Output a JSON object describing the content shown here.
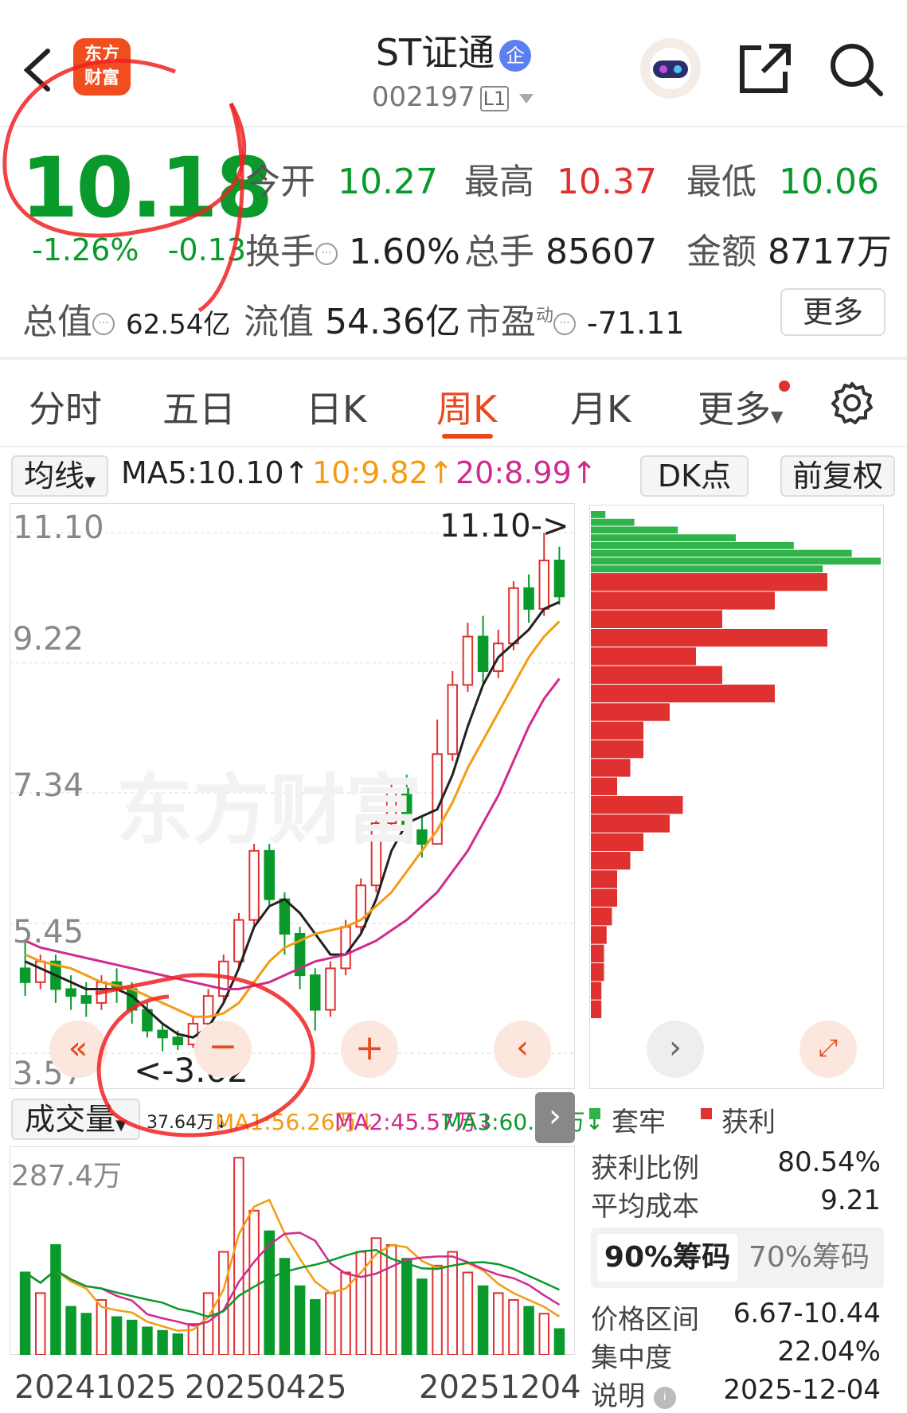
{
  "header": {
    "stock_name": "ST证通",
    "qi_badge": "企",
    "stock_code": "002197",
    "level_badge": "L1",
    "app_logo_text": [
      "东方",
      "财富"
    ]
  },
  "quote": {
    "price": "10.18",
    "change_pct": "-1.26%",
    "change_amt": "-0.13",
    "open_label": "今开",
    "open": "10.27",
    "high_label": "最高",
    "high": "10.37",
    "low_label": "最低",
    "low": "10.06",
    "turnover_label": "换手",
    "turnover": "1.60%",
    "volume_label": "总手",
    "volume": "85607",
    "amount_label": "金额",
    "amount": "8717万",
    "mktcap_label": "总值",
    "mktcap": "62.54亿",
    "float_label": "流值",
    "float_cap": "54.36亿",
    "pe_label": "市盈",
    "pe_sup": "动",
    "pe": "-71.11",
    "more_label": "更多"
  },
  "tabs": [
    {
      "label": "分时"
    },
    {
      "label": "五日"
    },
    {
      "label": "日K"
    },
    {
      "label": "周K"
    },
    {
      "label": "月K"
    },
    {
      "label": "更多"
    }
  ],
  "ma_bar": {
    "selector": "均线",
    "ma5": "MA5:10.10↑",
    "ma10": "10:9.82↑",
    "ma20": "20:8.99↑",
    "dk_label": "DK点",
    "adj_label": "前复权"
  },
  "price_axis": [
    "11.10",
    "9.22",
    "7.34",
    "5.45",
    "3.57"
  ],
  "annotations": {
    "high_marker": "11.10->",
    "low_marker": "<-3.62"
  },
  "watermark": "东方财富",
  "volume_bar": {
    "label": "成交量",
    "vol_value": "37.64万↓",
    "ma1": "MA1:56.26万↓",
    "ma2": "MA2:45.57万↓",
    "ma3": "MA3:60.52万↓",
    "axis_top": "287.4万"
  },
  "dates": [
    "20241025",
    "20250425",
    "20251204"
  ],
  "chip": {
    "legend_loss": "套牢",
    "legend_profit": "获利",
    "profit_ratio_label": "获利比例",
    "profit_ratio": "80.54%",
    "avg_cost_label": "平均成本",
    "avg_cost": "9.21",
    "tab90": "90%筹码",
    "tab70": "70%筹码",
    "range_label": "价格区间",
    "range": "6.67-10.44",
    "conc_label": "集中度",
    "conc": "22.04%",
    "note_label": "说明",
    "note_date": "2025-12-04"
  },
  "colors": {
    "up": "#e03131",
    "down": "#0a9a2c",
    "ma5": "#222222",
    "ma10": "#f39c12",
    "ma20": "#d02a8e",
    "accent": "#e8491d"
  },
  "chart_data": {
    "type": "candlestick",
    "title": "",
    "y_ticks": [
      11.1,
      9.22,
      7.34,
      5.45,
      3.57
    ],
    "ylim": [
      3.4,
      11.3
    ],
    "x_tick_labels": [
      "20241025",
      "20250425",
      "20251204"
    ],
    "candles": [
      [
        4.8,
        4.6,
        5.2,
        4.4
      ],
      [
        4.6,
        4.9,
        5.0,
        4.5
      ],
      [
        4.9,
        4.5,
        5.0,
        4.3
      ],
      [
        4.5,
        4.4,
        4.7,
        4.2
      ],
      [
        4.4,
        4.3,
        4.6,
        4.1
      ],
      [
        4.3,
        4.6,
        4.7,
        4.2
      ],
      [
        4.6,
        4.5,
        4.8,
        4.3
      ],
      [
        4.5,
        4.2,
        4.6,
        4.0
      ],
      [
        4.2,
        3.9,
        4.3,
        3.8
      ],
      [
        3.9,
        3.8,
        4.0,
        3.6
      ],
      [
        3.8,
        3.7,
        3.9,
        3.62
      ],
      [
        3.7,
        4.0,
        4.1,
        3.65
      ],
      [
        4.0,
        4.4,
        4.5,
        3.9
      ],
      [
        4.4,
        4.9,
        5.0,
        4.3
      ],
      [
        4.9,
        5.5,
        5.6,
        4.8
      ],
      [
        5.5,
        6.5,
        6.6,
        5.4
      ],
      [
        6.5,
        5.8,
        6.6,
        5.7
      ],
      [
        5.8,
        5.3,
        5.9,
        5.0
      ],
      [
        5.3,
        4.7,
        5.4,
        4.5
      ],
      [
        4.7,
        4.2,
        4.8,
        3.9
      ],
      [
        4.2,
        4.8,
        4.9,
        4.1
      ],
      [
        4.8,
        5.4,
        5.5,
        4.7
      ],
      [
        5.4,
        6.0,
        6.1,
        5.3
      ],
      [
        6.0,
        6.9,
        7.0,
        5.9
      ],
      [
        6.9,
        7.4,
        7.5,
        6.8
      ],
      [
        7.4,
        6.8,
        7.6,
        6.6
      ],
      [
        6.8,
        6.6,
        7.0,
        6.4
      ],
      [
        6.6,
        7.9,
        8.4,
        6.6
      ],
      [
        7.9,
        8.9,
        9.1,
        7.8
      ],
      [
        8.9,
        9.6,
        9.8,
        8.8
      ],
      [
        9.6,
        9.1,
        9.9,
        8.9
      ],
      [
        9.1,
        9.5,
        9.7,
        9.0
      ],
      [
        9.5,
        10.3,
        10.4,
        9.4
      ],
      [
        10.3,
        10.0,
        10.5,
        9.8
      ],
      [
        10.0,
        10.7,
        11.1,
        9.9
      ],
      [
        10.7,
        10.18,
        10.9,
        10.06
      ]
    ],
    "ma5": [
      4.9,
      4.8,
      4.7,
      4.6,
      4.5,
      4.5,
      4.5,
      4.4,
      4.2,
      4.0,
      3.85,
      3.8,
      3.95,
      4.3,
      4.8,
      5.4,
      5.7,
      5.8,
      5.6,
      5.3,
      5.0,
      5.0,
      5.3,
      5.8,
      6.5,
      6.9,
      7.0,
      7.1,
      7.6,
      8.3,
      8.9,
      9.3,
      9.5,
      9.7,
      10.0,
      10.1
    ],
    "ma10": [
      5.0,
      4.9,
      4.85,
      4.8,
      4.7,
      4.6,
      4.55,
      4.5,
      4.4,
      4.3,
      4.2,
      4.1,
      4.1,
      4.15,
      4.3,
      4.6,
      4.9,
      5.1,
      5.2,
      5.3,
      5.35,
      5.4,
      5.5,
      5.7,
      5.9,
      6.2,
      6.5,
      6.8,
      7.2,
      7.7,
      8.1,
      8.5,
      8.9,
      9.3,
      9.6,
      9.82
    ],
    "ma20": [
      5.2,
      5.1,
      5.05,
      5.0,
      4.95,
      4.9,
      4.85,
      4.8,
      4.75,
      4.7,
      4.65,
      4.6,
      4.55,
      4.5,
      4.5,
      4.55,
      4.6,
      4.7,
      4.8,
      4.9,
      4.95,
      5.0,
      5.1,
      5.2,
      5.35,
      5.5,
      5.7,
      5.9,
      6.2,
      6.5,
      6.9,
      7.3,
      7.8,
      8.3,
      8.7,
      8.99
    ],
    "volume_wan": [
      120,
      90,
      160,
      70,
      60,
      80,
      55,
      50,
      40,
      35,
      30,
      45,
      90,
      150,
      287,
      210,
      180,
      140,
      100,
      80,
      90,
      120,
      150,
      170,
      160,
      140,
      110,
      130,
      150,
      120,
      100,
      90,
      80,
      70,
      60,
      37.64
    ],
    "chip_distribution": {
      "price_range": [
        3.57,
        11.1
      ],
      "loss_levels": [
        0.05,
        0.15,
        0.3,
        0.5,
        0.7,
        0.9,
        1.0,
        0.8
      ],
      "profit_levels": [
        0.9,
        0.7,
        0.5,
        0.9,
        0.4,
        0.5,
        0.7,
        0.3,
        0.2,
        0.2,
        0.15,
        0.1,
        0.35,
        0.3,
        0.2,
        0.15,
        0.1,
        0.1,
        0.08,
        0.06,
        0.05,
        0.05,
        0.04,
        0.04
      ]
    }
  }
}
